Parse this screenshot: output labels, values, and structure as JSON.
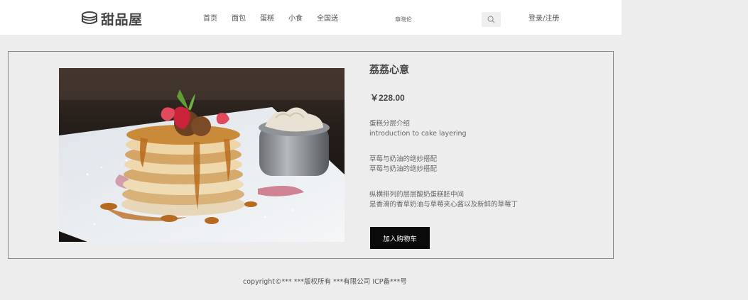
{
  "header": {
    "logo_text": "甜品屋",
    "logo_icon": "cake-icon",
    "nav": [
      {
        "label": "首页"
      },
      {
        "label": "面包"
      },
      {
        "label": "蛋糕"
      },
      {
        "label": "小食"
      },
      {
        "label": "全国送"
      }
    ],
    "username": "章晓伦",
    "search_icon": "search-icon",
    "login_label": "登录/注册"
  },
  "product": {
    "name": "荔荔心意",
    "price": "￥228.00",
    "description": [
      {
        "line1": "蛋糕分层介绍",
        "line2": "introduction to cake layering"
      },
      {
        "line1": "草莓与奶油的绝妙搭配",
        "line2": "草莓与奶油的绝妙搭配"
      },
      {
        "line1": "纵横排列的层层酸奶蛋糕胚中间",
        "line2": "是香滑的香草奶油与草莓夹心酱以及新鲜的草莓丁"
      }
    ],
    "cart_button_label": "加入购物车"
  },
  "footer": {
    "copyright": "copyright©*** ***版权所有 ***有限公司 ICP备***号"
  },
  "colors": {
    "header_bg": "#ffffff",
    "page_bg": "#ededed",
    "button_bg": "#0a0a0a",
    "button_text": "#ffffff"
  }
}
